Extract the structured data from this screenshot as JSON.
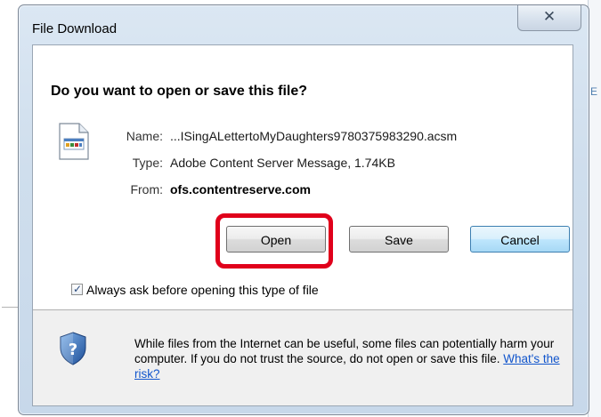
{
  "dialog": {
    "title": "File Download",
    "close_glyph": "✕",
    "question": "Do you want to open or save this file?",
    "file": {
      "name_label": "Name:",
      "name_value": "...ISingALettertoMyDaughters9780375983290.acsm",
      "type_label": "Type:",
      "type_value": "Adobe Content Server Message, 1.74KB",
      "from_label": "From:",
      "from_value": "ofs.contentreserve.com"
    },
    "buttons": {
      "open": "Open",
      "save": "Save",
      "cancel": "Cancel"
    },
    "always_ask": {
      "checked": true,
      "check_glyph": "✓",
      "label": "Always ask before opening this type of file"
    },
    "warning": {
      "text": "While files from the Internet can be useful, some files can potentially harm your computer. If you do not trust the source, do not open or save this file.",
      "link": "What's the risk?"
    },
    "icons": {
      "file": "acsm-file-icon",
      "shield": "security-shield-icon",
      "close": "close-icon"
    },
    "colors": {
      "highlight": "#e0001b",
      "link": "#1155cc",
      "frame": "#cfdeed"
    }
  },
  "background": {
    "accent_glyph": "E"
  }
}
